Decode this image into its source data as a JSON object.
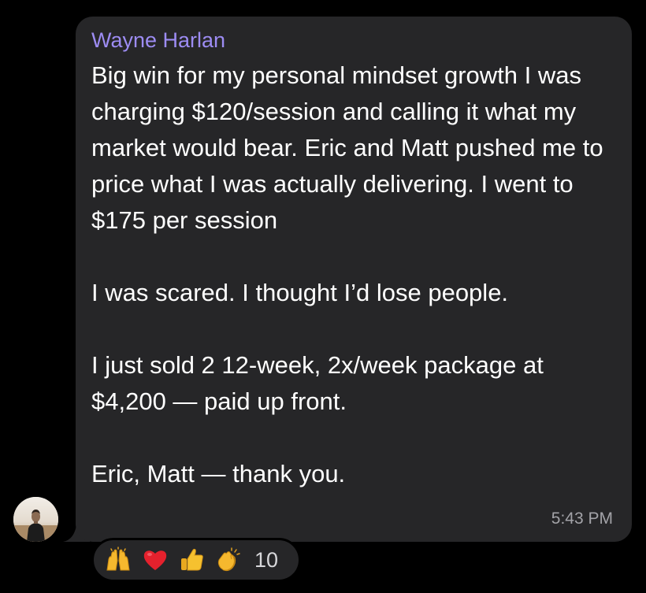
{
  "message": {
    "sender_name": "Wayne Harlan",
    "sender_color": "#9d8cf3",
    "paragraphs": [
      "Big win for my personal mindset growth I was charging $120/session and calling it what my market would bear. Eric and Matt pushed me to price what I was actually delivering. I went to $175 per session",
      "I was scared. I thought I’d lose people.",
      "I just sold 2 12-week, 2x/week package at $4,200 — paid up front.",
      "Eric, Matt — thank you."
    ],
    "timestamp": "5:43 PM",
    "bubble_color": "#262628"
  },
  "reactions": {
    "items": [
      {
        "icon": "raised-hands-icon"
      },
      {
        "icon": "red-heart-icon"
      },
      {
        "icon": "thumbs-up-icon"
      },
      {
        "icon": "clapping-hands-icon"
      }
    ],
    "count": "10"
  },
  "avatar": {
    "icon": "user-photo-avatar"
  }
}
